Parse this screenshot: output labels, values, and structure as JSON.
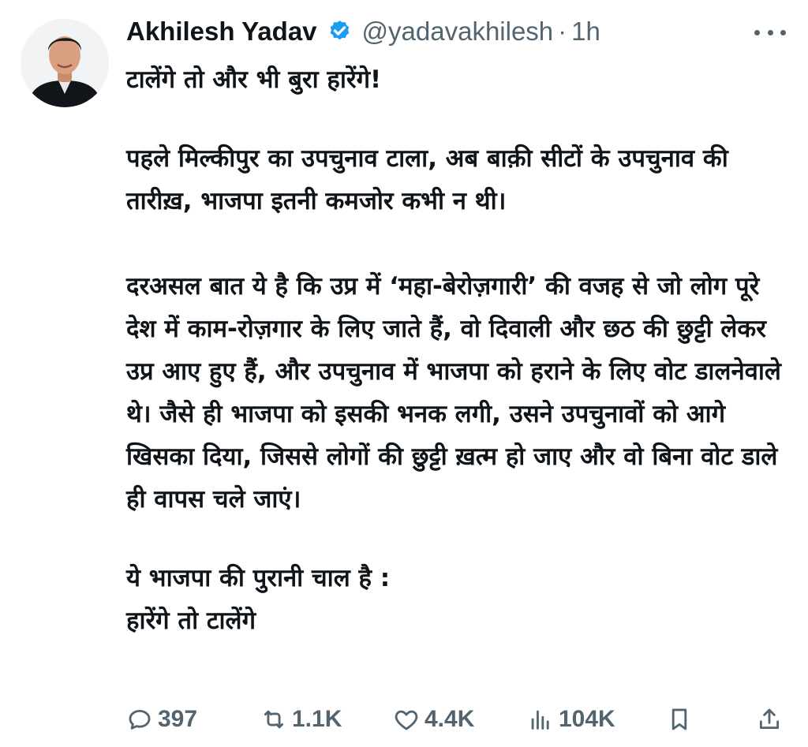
{
  "author": {
    "name": "Akhilesh Yadav",
    "handle": "@yadavakhilesh",
    "separator": "·",
    "time": "1h",
    "verified_color": "#1d9bf0"
  },
  "post": {
    "paragraphs": [
      "टालेंगे तो और भी बुरा हारेंगे!",
      "पहले मिल्कीपुर का उपचुनाव टाला, अब बाक़ी सीटों के उपचुनाव की तारीख़, भाजपा इतनी कमजोर कभी न थी।",
      "दरअसल बात ये है कि उप्र में ‘महा-बेरोज़गारी’ की वजह से जो लोग पूरे देश में  काम-रोज़गार के लिए जाते हैं, वो दिवाली और छठ की छुट्टी लेकर उप्र आए हुए हैं, और उपचुनाव में भाजपा को हराने के लिए वोट डालनेवाले थे। जैसे ही भाजपा को इसकी भनक लगी, उसने उपचुनावों को आगे खिसका दिया, जिससे लोगों की छुट्टी ख़त्म हो जाए और वो बिना वोट डाले ही वापस चले जाएं।",
      "ये भाजपा की पुरानी चाल है :",
      "हारेंगे तो टालेंगे"
    ]
  },
  "actions": {
    "replies": "397",
    "reposts": "1.1K",
    "likes": "4.4K",
    "views": "104K"
  },
  "icons": {
    "more": "more-horizontal-icon",
    "reply": "reply-icon",
    "repost": "repost-icon",
    "like": "heart-icon",
    "views": "views-icon",
    "bookmark": "bookmark-icon",
    "share": "share-icon"
  },
  "colors": {
    "text": "#0f1419",
    "secondary": "#536471",
    "accent": "#1d9bf0"
  }
}
